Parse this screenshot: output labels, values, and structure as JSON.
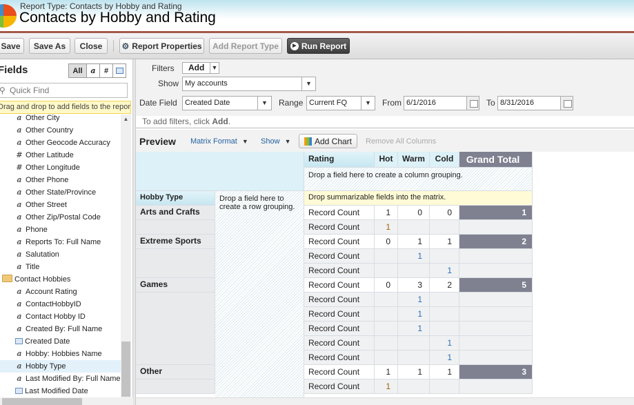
{
  "header": {
    "report_type": "Report Type: Contacts by Hobby and Rating",
    "title": "Contacts by Hobby and Rating"
  },
  "toolbar": {
    "save": "Save",
    "save_as": "Save As",
    "close": "Close",
    "report_properties": "Report Properties",
    "add_report_type": "Add Report Type",
    "run_report": "Run Report"
  },
  "fields_panel": {
    "title": "Fields",
    "type_filters": [
      "All",
      "a",
      "#",
      "date"
    ],
    "quick_find_placeholder": "Quick Find",
    "hint": "Drag and drop to add fields to the report.",
    "items": [
      {
        "label": "Other City",
        "type": "text"
      },
      {
        "label": "Other Country",
        "type": "text"
      },
      {
        "label": "Other Geocode Accuracy",
        "type": "text"
      },
      {
        "label": "Other Latitude",
        "type": "number"
      },
      {
        "label": "Other Longitude",
        "type": "number"
      },
      {
        "label": "Other Phone",
        "type": "text"
      },
      {
        "label": "Other State/Province",
        "type": "text"
      },
      {
        "label": "Other Street",
        "type": "text"
      },
      {
        "label": "Other Zip/Postal Code",
        "type": "text"
      },
      {
        "label": "Phone",
        "type": "text"
      },
      {
        "label": "Reports To: Full Name",
        "type": "text"
      },
      {
        "label": "Salutation",
        "type": "text"
      },
      {
        "label": "Title",
        "type": "text"
      },
      {
        "label": "Contact Hobbies",
        "type": "folder"
      },
      {
        "label": "Account Rating",
        "type": "text"
      },
      {
        "label": "ContactHobbyID",
        "type": "text"
      },
      {
        "label": "Contact Hobby ID",
        "type": "text"
      },
      {
        "label": "Created By: Full Name",
        "type": "text"
      },
      {
        "label": "Created Date",
        "type": "date"
      },
      {
        "label": "Hobby: Hobbies Name",
        "type": "text"
      },
      {
        "label": "Hobby Type",
        "type": "text",
        "selected": true
      },
      {
        "label": "Last Modified By: Full Name",
        "type": "text"
      },
      {
        "label": "Last Modified Date",
        "type": "date"
      }
    ]
  },
  "filters": {
    "filters_label": "Filters",
    "add": "Add",
    "show_label": "Show",
    "show_value": "My accounts",
    "date_field_label": "Date Field",
    "date_field_value": "Created Date",
    "range_label": "Range",
    "range_value": "Current FQ",
    "from_label": "From",
    "from_value": "6/1/2016",
    "to_label": "To",
    "to_value": "8/31/2016",
    "hint_prefix": "To add filters, click ",
    "hint_link": "Add",
    "hint_suffix": "."
  },
  "preview": {
    "title": "Preview",
    "format": "Matrix Format",
    "show": "Show",
    "add_chart": "Add Chart",
    "remove_all_columns": "Remove All Columns"
  },
  "matrix": {
    "rating_header": "Rating",
    "columns": [
      "Hot",
      "Warm",
      "Cold"
    ],
    "grand_total": "Grand Total",
    "col_drop": "Drop a field here to create a column grouping.",
    "row_header": "Hobby Type",
    "row_drop": "Drop a field here to create a row grouping.",
    "summ_drop": "Drop summarizable fields into the matrix.",
    "rows": [
      {
        "group": "Arts and Crafts",
        "label": "Record Count",
        "values": [
          "1",
          "0",
          "0"
        ],
        "total": "1"
      },
      {
        "group": "",
        "label": "Record Count",
        "values": [
          "1",
          "",
          ""
        ],
        "total": ""
      },
      {
        "group": "Extreme Sports",
        "label": "Record Count",
        "values": [
          "0",
          "1",
          "1"
        ],
        "total": "2"
      },
      {
        "group": "",
        "label": "Record Count",
        "values": [
          "",
          "1",
          ""
        ],
        "total": ""
      },
      {
        "group": "",
        "label": "Record Count",
        "values": [
          "",
          "",
          "1"
        ],
        "total": ""
      },
      {
        "group": "Games",
        "label": "Record Count",
        "values": [
          "0",
          "3",
          "2"
        ],
        "total": "5"
      },
      {
        "group": "",
        "label": "Record Count",
        "values": [
          "",
          "1",
          ""
        ],
        "total": ""
      },
      {
        "group": "",
        "label": "Record Count",
        "values": [
          "",
          "1",
          ""
        ],
        "total": ""
      },
      {
        "group": "",
        "label": "Record Count",
        "values": [
          "",
          "1",
          ""
        ],
        "total": ""
      },
      {
        "group": "",
        "label": "Record Count",
        "values": [
          "",
          "",
          "1"
        ],
        "total": ""
      },
      {
        "group": "",
        "label": "Record Count",
        "values": [
          "",
          "",
          "1"
        ],
        "total": ""
      },
      {
        "group": "Other",
        "label": "Record Count",
        "values": [
          "1",
          "1",
          "1"
        ],
        "total": "3"
      },
      {
        "group": "",
        "label": "Record Count",
        "values": [
          "1",
          "",
          ""
        ],
        "total": ""
      }
    ],
    "detail_colors": {
      "hot": "#a0620f",
      "warm": "#2a6fb5",
      "cold": "#2a6fb5"
    }
  }
}
